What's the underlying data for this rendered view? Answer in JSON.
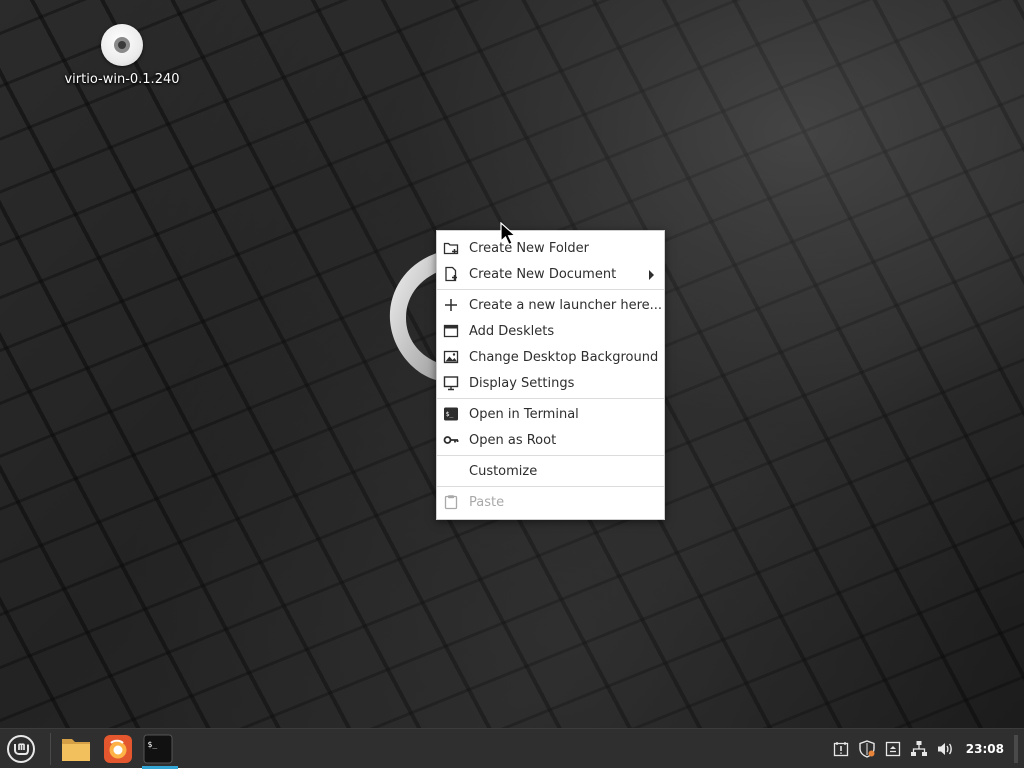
{
  "desktop": {
    "icons": [
      {
        "label": "virtio-win-0.1.240",
        "icon": "cd-disc-icon"
      }
    ]
  },
  "context_menu": {
    "sections": [
      [
        {
          "label": "Create New Folder",
          "icon": "folder-add-icon"
        },
        {
          "label": "Create New Document",
          "icon": "document-add-icon",
          "submenu": true
        }
      ],
      [
        {
          "label": "Create a new launcher here...",
          "icon": "plus-icon"
        },
        {
          "label": "Add Desklets",
          "icon": "desklet-icon"
        },
        {
          "label": "Change Desktop Background",
          "icon": "image-icon"
        },
        {
          "label": "Display Settings",
          "icon": "monitor-icon"
        }
      ],
      [
        {
          "label": "Open in Terminal",
          "icon": "terminal-icon"
        },
        {
          "label": "Open as Root",
          "icon": "key-icon"
        }
      ],
      [
        {
          "label": "Customize",
          "icon": ""
        }
      ],
      [
        {
          "label": "Paste",
          "icon": "clipboard-icon",
          "disabled": true
        }
      ]
    ]
  },
  "panel": {
    "launchers": [
      {
        "name": "files",
        "icon": "folder-icon"
      },
      {
        "name": "firefox",
        "icon": "firefox-icon"
      },
      {
        "name": "terminal",
        "icon": "terminal-icon",
        "active": true
      }
    ],
    "tray": [
      "update-shield-icon",
      "network-icon",
      "volume-icon"
    ],
    "clock": "23:08"
  }
}
